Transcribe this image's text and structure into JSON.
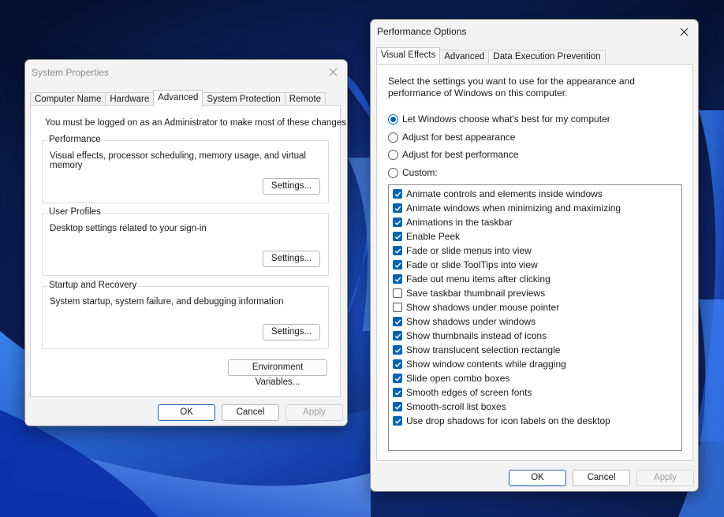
{
  "system_properties": {
    "title": "System Properties",
    "tabs": [
      {
        "label": "Computer Name",
        "active": false
      },
      {
        "label": "Hardware",
        "active": false
      },
      {
        "label": "Advanced",
        "active": true
      },
      {
        "label": "System Protection",
        "active": false
      },
      {
        "label": "Remote",
        "active": false
      }
    ],
    "admin_note": "You must be logged on as an Administrator to make most of these changes.",
    "groups": [
      {
        "label": "Performance",
        "description": "Visual effects, processor scheduling, memory usage, and virtual memory",
        "button": "Settings..."
      },
      {
        "label": "User Profiles",
        "description": "Desktop settings related to your sign-in",
        "button": "Settings..."
      },
      {
        "label": "Startup and Recovery",
        "description": "System startup, system failure, and debugging information",
        "button": "Settings..."
      }
    ],
    "env_button": "Environment Variables...",
    "ok_label": "OK",
    "cancel_label": "Cancel",
    "apply_label": "Apply"
  },
  "performance_options": {
    "title": "Performance Options",
    "tabs": [
      {
        "label": "Visual Effects",
        "active": true
      },
      {
        "label": "Advanced",
        "active": false
      },
      {
        "label": "Data Execution Prevention",
        "active": false
      }
    ],
    "intro": "Select the settings you want to use for the appearance and performance of Windows on this computer.",
    "intro_line1": "Select the settings you want to use for the appearance and",
    "intro_line2": "performance of Windows on this computer.",
    "radios": [
      {
        "label": "Let Windows choose what's best for my computer",
        "checked": true
      },
      {
        "label": "Adjust for best appearance",
        "checked": false
      },
      {
        "label": "Adjust for best performance",
        "checked": false
      },
      {
        "label": "Custom:",
        "checked": false
      }
    ],
    "effects": [
      {
        "label": "Animate controls and elements inside windows",
        "checked": true
      },
      {
        "label": "Animate windows when minimizing and maximizing",
        "checked": true
      },
      {
        "label": "Animations in the taskbar",
        "checked": true
      },
      {
        "label": "Enable Peek",
        "checked": true
      },
      {
        "label": "Fade or slide menus into view",
        "checked": true
      },
      {
        "label": "Fade or slide ToolTips into view",
        "checked": true
      },
      {
        "label": "Fade out menu items after clicking",
        "checked": true
      },
      {
        "label": "Save taskbar thumbnail previews",
        "checked": false
      },
      {
        "label": "Show shadows under mouse pointer",
        "checked": false
      },
      {
        "label": "Show shadows under windows",
        "checked": true
      },
      {
        "label": "Show thumbnails instead of icons",
        "checked": true
      },
      {
        "label": "Show translucent selection rectangle",
        "checked": true
      },
      {
        "label": "Show window contents while dragging",
        "checked": true
      },
      {
        "label": "Slide open combo boxes",
        "checked": true
      },
      {
        "label": "Smooth edges of screen fonts",
        "checked": true
      },
      {
        "label": "Smooth-scroll list boxes",
        "checked": true
      },
      {
        "label": "Use drop shadows for icon labels on the desktop",
        "checked": true
      }
    ],
    "ok_label": "OK",
    "cancel_label": "Cancel",
    "apply_label": "Apply"
  },
  "colors": {
    "accent": "#0063b1",
    "wallpaper_dark": "#0a1a48",
    "wallpaper_blue": "#2a6fe8"
  }
}
